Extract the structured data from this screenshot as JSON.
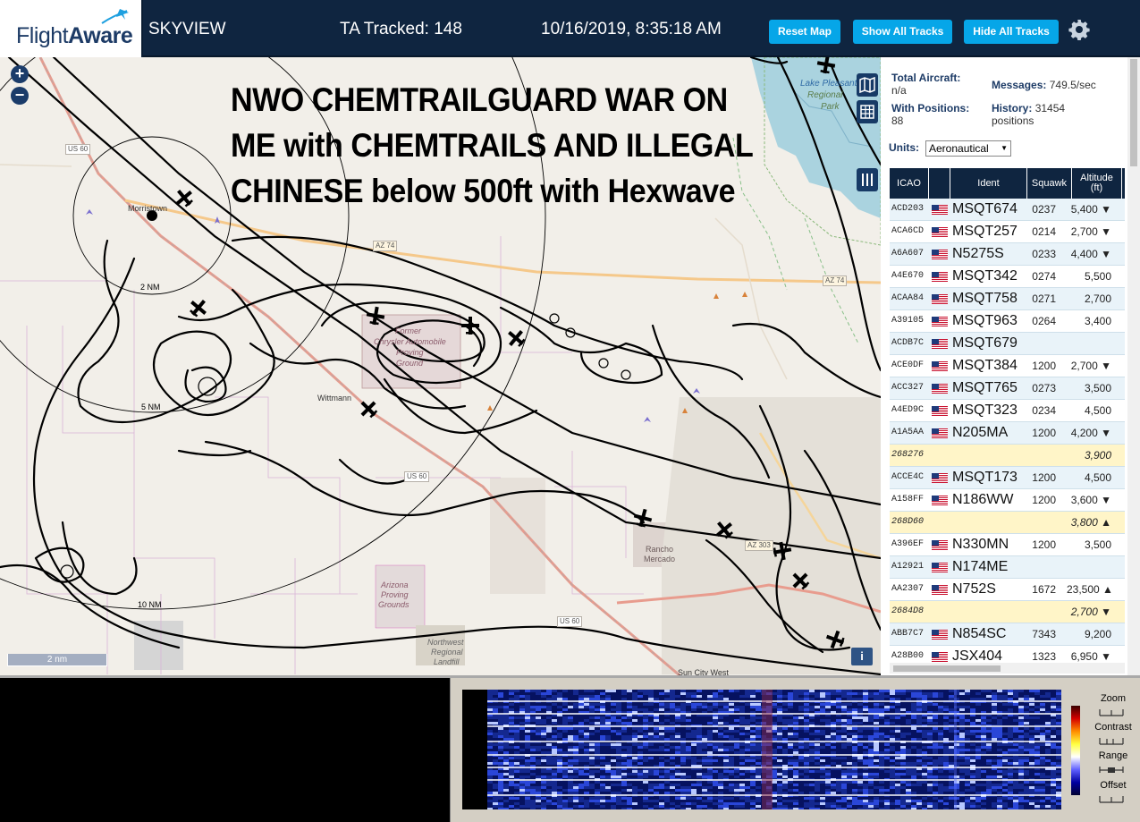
{
  "header": {
    "logo_text_regular": "Flight",
    "logo_text_bold": "Aware",
    "app_name": "SKYVIEW",
    "tracked": "TA Tracked: 148",
    "datetime": "10/16/2019, 8:35:18 AM",
    "reset_label": "Reset Map",
    "show_tracks_label": "Show All Tracks",
    "hide_tracks_label": "Hide All Tracks",
    "gear_icon": "gear-icon",
    "accent_color": "#06a6e8",
    "bar_color": "#0f2540"
  },
  "map": {
    "heading_lines": [
      "NWO CHEMTRAILGUARD WAR ON",
      "ME with CHEMTRAILS AND ILLEGAL",
      "CHINESE below 500ft with Hexwave"
    ],
    "zoom_in": "+",
    "zoom_out": "−",
    "scale_label": "2 nm",
    "info_label": "i",
    "labels": {
      "lake": "Lake Pleasant",
      "park1": "Regional",
      "park2": "Park",
      "morristown": "Morristown",
      "wittmann": "Wittmann",
      "chrysler1": "Former",
      "chrysler2": "Chrysler Automobile",
      "chrysler3": "Proving",
      "chrysler4": "Ground",
      "rancho1": "Rancho",
      "rancho2": "Mercado",
      "az_proving1": "Arizona",
      "az_proving2": "Proving",
      "az_proving3": "Grounds",
      "landfill1": "Northwest",
      "landfill2": "Regional",
      "landfill3": "Landfill",
      "suncity": "Sun City West",
      "us60_a": "US 60",
      "us60_b": "US 60",
      "us60_c": "US 60",
      "az74_a": "AZ 74",
      "az74_b": "AZ 74",
      "az303": "AZ 303",
      "ring2": "2 NM",
      "ring5": "5 NM",
      "ring10": "10 NM"
    }
  },
  "sidebar": {
    "total_label": "Total Aircraft:",
    "total_value": "n/a",
    "messages_label": "Messages:",
    "messages_value": "749.5/sec",
    "positions_label": "With Positions:",
    "positions_value": "88",
    "history_label": "History:",
    "history_value": "31454",
    "history_unit": "positions",
    "units_label": "Units:",
    "units_value": "Aeronautical",
    "columns": [
      "ICAO",
      "",
      "Ident",
      "Squawk",
      "Altitude (ft)"
    ],
    "rows": [
      {
        "icao": "ACD203",
        "flag": true,
        "ident": "MSQT674",
        "squawk": "0237",
        "alt": "5,400 ▼",
        "style": "alt"
      },
      {
        "icao": "ACA6CD",
        "flag": true,
        "ident": "MSQT257",
        "squawk": "0214",
        "alt": "2,700 ▼",
        "style": ""
      },
      {
        "icao": "A6A607",
        "flag": true,
        "ident": "N5275S",
        "squawk": "0233",
        "alt": "4,400 ▼",
        "style": "alt"
      },
      {
        "icao": "A4E670",
        "flag": true,
        "ident": "MSQT342",
        "squawk": "0274",
        "alt": "5,500",
        "style": ""
      },
      {
        "icao": "ACAA84",
        "flag": true,
        "ident": "MSQT758",
        "squawk": "0271",
        "alt": "2,700",
        "style": "alt"
      },
      {
        "icao": "A39105",
        "flag": true,
        "ident": "MSQT963",
        "squawk": "0264",
        "alt": "3,400",
        "style": ""
      },
      {
        "icao": "ACDB7C",
        "flag": true,
        "ident": "MSQT679",
        "squawk": "",
        "alt": "",
        "style": "alt"
      },
      {
        "icao": "ACE0DF",
        "flag": true,
        "ident": "MSQT384",
        "squawk": "1200",
        "alt": "2,700 ▼",
        "style": ""
      },
      {
        "icao": "ACC327",
        "flag": true,
        "ident": "MSQT765",
        "squawk": "0273",
        "alt": "3,500",
        "style": "alt"
      },
      {
        "icao": "A4ED9C",
        "flag": true,
        "ident": "MSQT323",
        "squawk": "0234",
        "alt": "4,500",
        "style": ""
      },
      {
        "icao": "A1A5AA",
        "flag": true,
        "ident": "N205MA",
        "squawk": "1200",
        "alt": "4,200 ▼",
        "style": "alt"
      },
      {
        "icao": "268276",
        "flag": false,
        "ident": "",
        "squawk": "",
        "alt": "3,900",
        "style": "yel"
      },
      {
        "icao": "ACCE4C",
        "flag": true,
        "ident": "MSQT173",
        "squawk": "1200",
        "alt": "4,500",
        "style": "alt"
      },
      {
        "icao": "A158FF",
        "flag": true,
        "ident": "N186WW",
        "squawk": "1200",
        "alt": "3,600 ▼",
        "style": ""
      },
      {
        "icao": "268D60",
        "flag": false,
        "ident": "",
        "squawk": "",
        "alt": "3,800 ▲",
        "style": "yel"
      },
      {
        "icao": "A396EF",
        "flag": true,
        "ident": "N330MN",
        "squawk": "1200",
        "alt": "3,500",
        "style": ""
      },
      {
        "icao": "A12921",
        "flag": true,
        "ident": "N174ME",
        "squawk": "",
        "alt": "",
        "style": "alt"
      },
      {
        "icao": "AA2307",
        "flag": true,
        "ident": "N752S",
        "squawk": "1672",
        "alt": "23,500 ▲",
        "style": ""
      },
      {
        "icao": "2684D8",
        "flag": false,
        "ident": "",
        "squawk": "",
        "alt": "2,700 ▼",
        "style": "yel"
      },
      {
        "icao": "ABB7C7",
        "flag": true,
        "ident": "N854SC",
        "squawk": "7343",
        "alt": "9,200",
        "style": "alt"
      },
      {
        "icao": "A28B00",
        "flag": true,
        "ident": "JSX404",
        "squawk": "1323",
        "alt": "6,950 ▼",
        "style": ""
      }
    ]
  },
  "spectrum": {
    "zoom_label": "Zoom",
    "contrast_label": "Contrast",
    "range_label": "Range",
    "offset_label": "Offset"
  }
}
